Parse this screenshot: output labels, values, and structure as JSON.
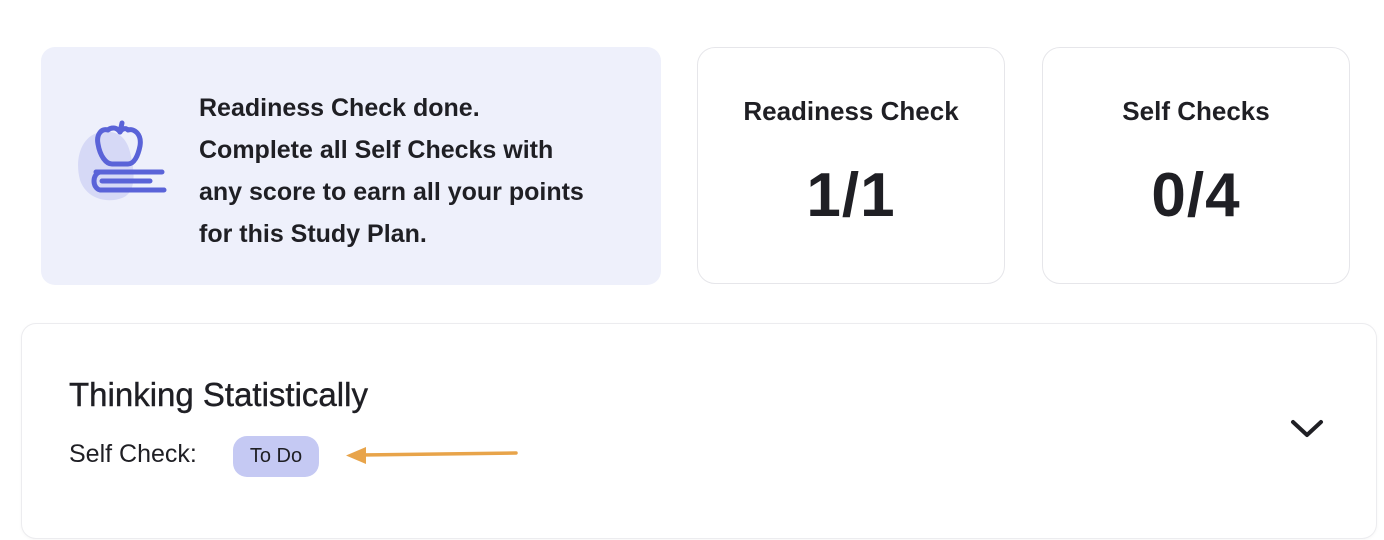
{
  "info_card": {
    "icon": "apple-on-book-icon",
    "line1": "Readiness Check done.",
    "line2": "Complete all Self Checks with",
    "line3": "any score to earn all your points",
    "line4": "for this Study Plan."
  },
  "stats": {
    "readiness": {
      "title": "Readiness Check",
      "value": "1/1"
    },
    "self_checks": {
      "title": "Self Checks",
      "value": "0/4"
    }
  },
  "section": {
    "title": "Thinking Statistically",
    "self_check_label": "Self Check:",
    "status_badge": "To Do",
    "expand_icon": "chevron-down-icon",
    "annotation_icon": "arrow-left-icon"
  },
  "colors": {
    "info_bg": "#eef0fb",
    "icon_accent": "#5a63d8",
    "badge_bg": "#c5c9f3",
    "arrow": "#e8a44a",
    "text": "#1f1f24"
  }
}
